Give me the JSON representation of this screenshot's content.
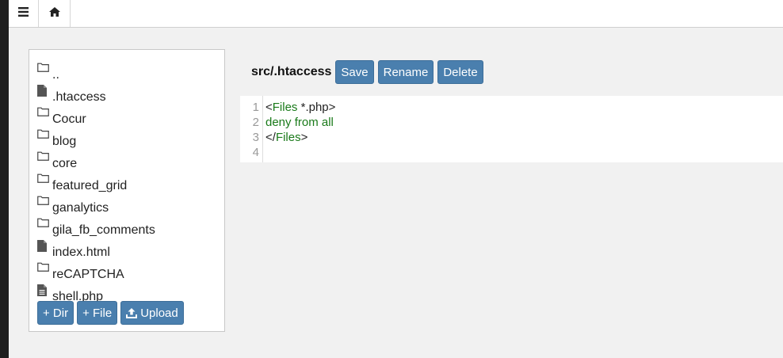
{
  "toolbar": {
    "menu_icon": "hamburger-icon",
    "home_icon": "home-icon"
  },
  "file_tree": {
    "items": [
      {
        "name": "..",
        "type": "folder"
      },
      {
        "name": ".htaccess",
        "type": "file"
      },
      {
        "name": "Cocur",
        "type": "folder"
      },
      {
        "name": "blog",
        "type": "folder"
      },
      {
        "name": "core",
        "type": "folder"
      },
      {
        "name": "featured_grid",
        "type": "folder"
      },
      {
        "name": "ganalytics",
        "type": "folder"
      },
      {
        "name": "gila_fb_comments",
        "type": "folder"
      },
      {
        "name": "index.html",
        "type": "file"
      },
      {
        "name": "reCAPTCHA",
        "type": "folder"
      },
      {
        "name": "shell.php",
        "type": "file-text"
      }
    ],
    "add_dir_label": "+ Dir",
    "add_file_label": "+ File",
    "upload_label": "Upload"
  },
  "editor": {
    "file_path": "src/.htaccess",
    "save_label": "Save",
    "rename_label": "Rename",
    "delete_label": "Delete",
    "line_numbers": [
      "1",
      "2",
      "3",
      "4"
    ],
    "lines": {
      "l1_open": "<",
      "l1_tag": "Files",
      "l1_rest": " *.php",
      "l1_close": ">",
      "l2": "deny from all",
      "l3_open": "</",
      "l3_tag": "Files",
      "l3_close": ">",
      "l4": ""
    }
  },
  "colors": {
    "button": "#4a7fae",
    "code_keyword": "#1a7a1a",
    "sidebar_strip": "#1e1e1e"
  }
}
